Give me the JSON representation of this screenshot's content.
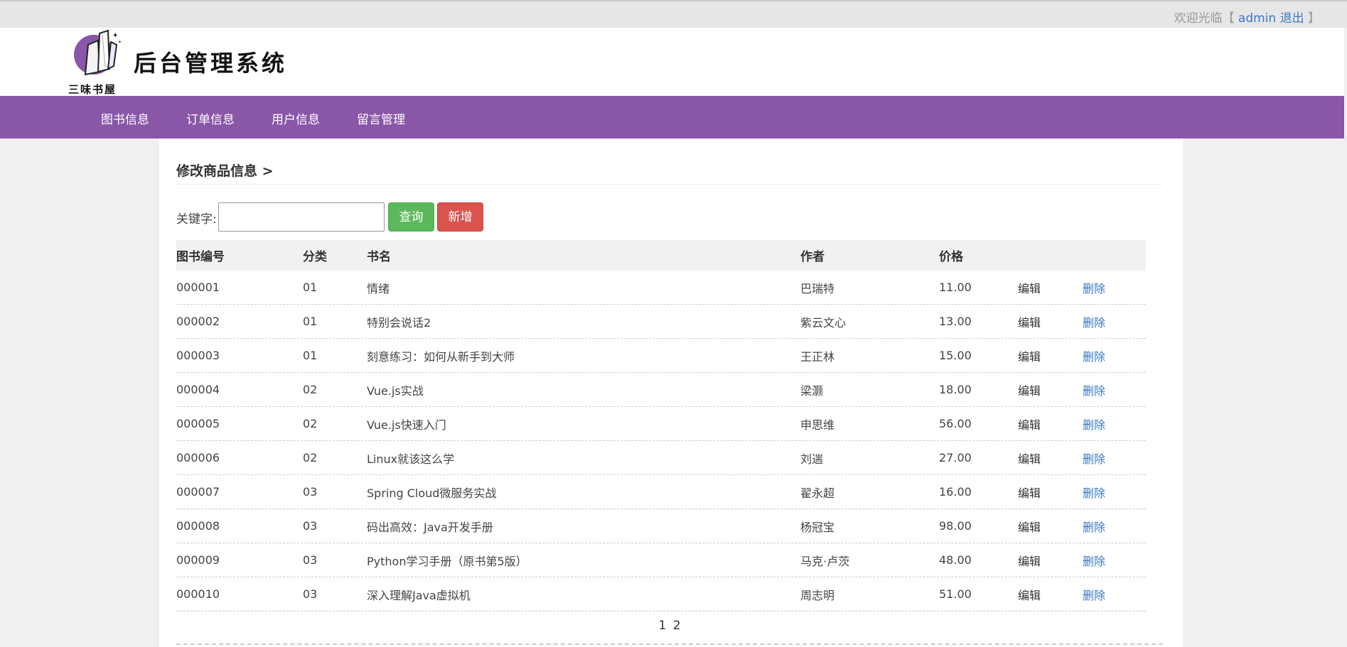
{
  "topbar": {
    "welcome_prefix": "欢迎光临【",
    "user": "admin",
    "logout": "退出",
    "welcome_suffix": "】"
  },
  "header": {
    "logo_text": "三味书屋",
    "system_title": "后台管理系统"
  },
  "nav": {
    "items": [
      {
        "label": "图书信息"
      },
      {
        "label": "订单信息"
      },
      {
        "label": "用户信息"
      },
      {
        "label": "留言管理"
      }
    ]
  },
  "main": {
    "breadcrumb": "修改商品信息 >",
    "search": {
      "label": "关键字:",
      "value": "",
      "placeholder": ""
    },
    "buttons": {
      "query": "查询",
      "add": "新增"
    },
    "table": {
      "headers": {
        "id": "图书编号",
        "category": "分类",
        "name": "书名",
        "author": "作者",
        "price": "价格"
      },
      "action_edit": "编辑",
      "action_delete": "删除",
      "rows": [
        {
          "id": "000001",
          "category": "01",
          "name": "情绪",
          "author": "巴瑞特",
          "price": "11.00"
        },
        {
          "id": "000002",
          "category": "01",
          "name": "特别会说话2",
          "author": "紫云文心",
          "price": "13.00"
        },
        {
          "id": "000003",
          "category": "01",
          "name": "刻意练习：如何从新手到大师",
          "author": "王正林",
          "price": "15.00"
        },
        {
          "id": "000004",
          "category": "02",
          "name": "Vue.js实战",
          "author": "梁灏",
          "price": "18.00"
        },
        {
          "id": "000005",
          "category": "02",
          "name": "Vue.js快速入门",
          "author": "申思维",
          "price": "56.00"
        },
        {
          "id": "000006",
          "category": "02",
          "name": "Linux就该这么学",
          "author": "刘遄",
          "price": "27.00"
        },
        {
          "id": "000007",
          "category": "03",
          "name": "Spring Cloud微服务实战",
          "author": "翟永超",
          "price": "16.00"
        },
        {
          "id": "000008",
          "category": "03",
          "name": "码出高效：Java开发手册",
          "author": "杨冠宝",
          "price": "98.00"
        },
        {
          "id": "000009",
          "category": "03",
          "name": "Python学习手册（原书第5版）",
          "author": "马克·卢茨",
          "price": "48.00"
        },
        {
          "id": "000010",
          "category": "03",
          "name": "深入理解Java虚拟机",
          "author": "周志明",
          "price": "51.00"
        }
      ]
    },
    "pagination": {
      "pages": [
        "1",
        "2"
      ]
    }
  },
  "colors": {
    "nav_bg": "#8956a8",
    "query_btn": "#5cb85c",
    "add_btn": "#d9534f",
    "link": "#3a78c3"
  }
}
